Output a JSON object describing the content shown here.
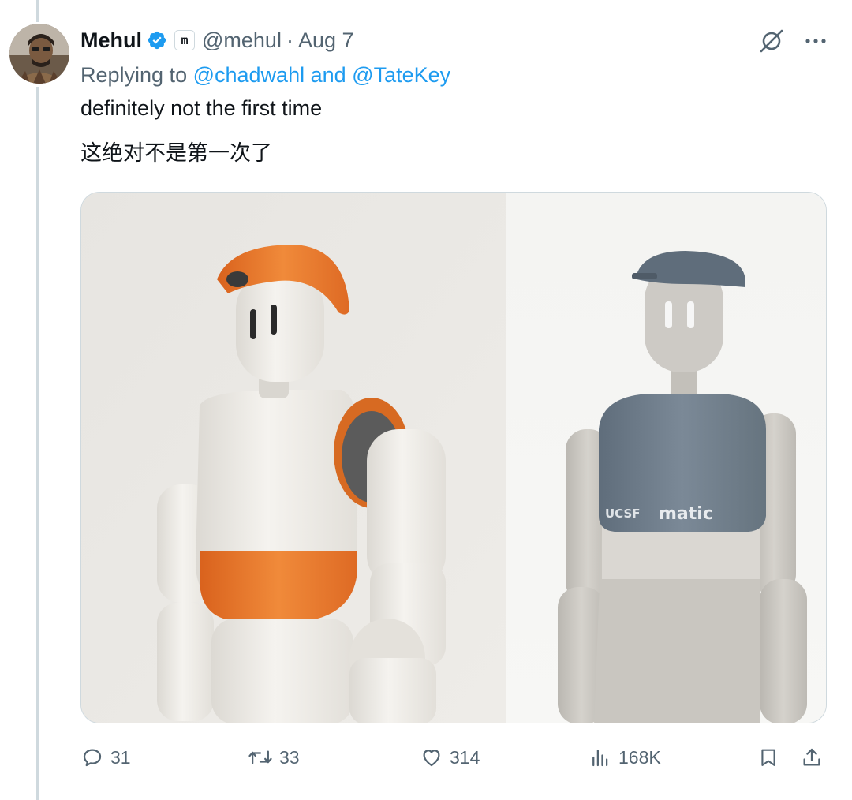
{
  "tweet": {
    "author": {
      "name": "Mehul",
      "affiliation_badge": "m",
      "handle": "@mehul",
      "separator": "·",
      "date": "Aug 7",
      "verified_icon": "verified-badge-icon"
    },
    "replying_prefix": "Replying to ",
    "replying_to": [
      "@chadwahl",
      "@TateKey"
    ],
    "replying_joiner": " and ",
    "text_line_1": "definitely not the first time",
    "text_line_2": "这绝对不是第一次了",
    "media": {
      "left_image": "white-orange-robot-with-cap",
      "right_image": "grey-robot-with-cap",
      "logo_left": "UCSF",
      "logo_right": "matic"
    }
  },
  "top_actions": {
    "grok_icon": "grok-icon",
    "more_icon": "more-icon"
  },
  "actions": {
    "replies": "31",
    "reposts": "33",
    "likes": "314",
    "views": "168K"
  },
  "colors": {
    "accent": "#1d9bf0",
    "text_primary": "#0f1419",
    "text_secondary": "#536471",
    "border": "#cfd9de",
    "robot_orange": "#e9772c",
    "robot_grey": "#6f7e8c"
  }
}
